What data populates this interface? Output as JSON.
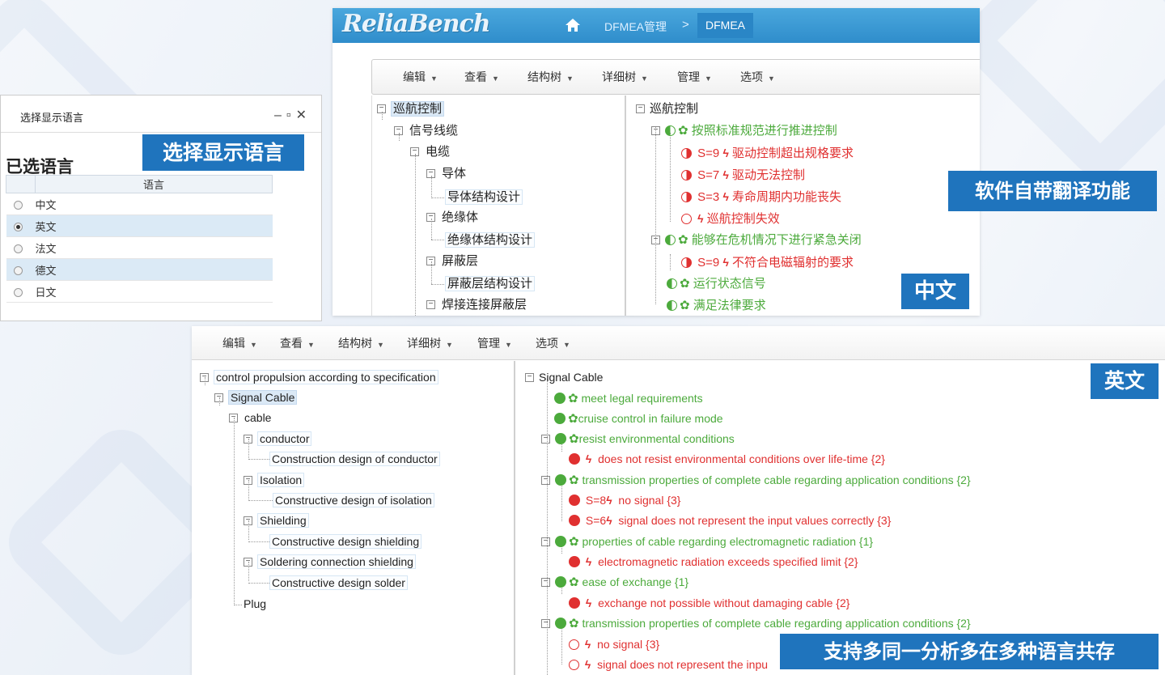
{
  "callouts": {
    "language": "选择显示语言",
    "translation": "软件自带翻译功能",
    "chinese": "中文",
    "english": "英文",
    "coexist": "支持多同一分析多在多种语言共存"
  },
  "cn_app": {
    "logo": "ReliaBench",
    "breadcrumb": [
      "DFMEA管理",
      ">",
      "DFMEA"
    ],
    "menu": [
      "编辑",
      "查看",
      "结构树",
      "详细树",
      "管理",
      "选项"
    ],
    "structure_tree": [
      "巡航控制",
      "信号线缆",
      "电缆",
      "导体",
      "导体结构设计",
      "绝缘体",
      "绝缘体结构设计",
      "屏蔽层",
      "屏蔽层结构设计",
      "焊接连接屏蔽层"
    ],
    "detail_tree": {
      "root": "巡航控制",
      "func1": "按照标准规范进行推进控制",
      "f1": [
        "S=9",
        "驱动控制超出规格要求"
      ],
      "f2": [
        "S=7",
        "驱动无法控制"
      ],
      "f3": [
        "S=3",
        "寿命周期内功能丧失"
      ],
      "f4": "巡航控制失效",
      "func2": "能够在危机情况下进行紧急关闭",
      "f5": [
        "S=9",
        "不符合电磁辐射的要求"
      ],
      "func3": "运行状态信号",
      "func4": "满足法律要求"
    }
  },
  "lang_dialog": {
    "title": "选择显示语言",
    "heading": "已选语言",
    "column": "语言",
    "languages": [
      "中文",
      "英文",
      "法文",
      "德文",
      "日文"
    ],
    "selected": "英文"
  },
  "en_app": {
    "menu": [
      "编辑",
      "查看",
      "结构树",
      "详细树",
      "管理",
      "选项"
    ],
    "structure_tree": [
      "control propulsion according to specification",
      "Signal Cable",
      "cable",
      "conductor",
      "Construction design of conductor",
      "Isolation",
      "Constructive design of isolation",
      "Shielding",
      "Constructive design shielding",
      "Soldering connection shielding",
      "Constructive design solder",
      "Plug"
    ],
    "detail_tree": {
      "root": "Signal Cable",
      "l1": "meet legal requirements",
      "l2": "cruise control in failure mode",
      "l3": "resist environmental conditions",
      "l4": "does not resist environmental conditions over life-time {2}",
      "l5": "transmission properties of complete cable regarding application conditions {2}",
      "l6s": "S=8",
      "l6": "no signal {3}",
      "l7s": "S=6",
      "l7": "signal does not represent the input values correctly {3}",
      "l8": "properties of cable regarding electromagnetic radiation {1}",
      "l9": "electromagnetic radiation exceeds specified limit {2}",
      "l10": "ease of exchange {1}",
      "l11": "exchange not possible without damaging cable {2}",
      "l12": "transmission properties of complete cable regarding application conditions {2}",
      "l13": "no signal {3}",
      "l14": "signal does not represent the inpu"
    }
  },
  "colors": {
    "accent": "#1f74bd",
    "function_green": "#4caa3c",
    "failure_red": "#e03030",
    "header_blue": "#3a97d3"
  }
}
